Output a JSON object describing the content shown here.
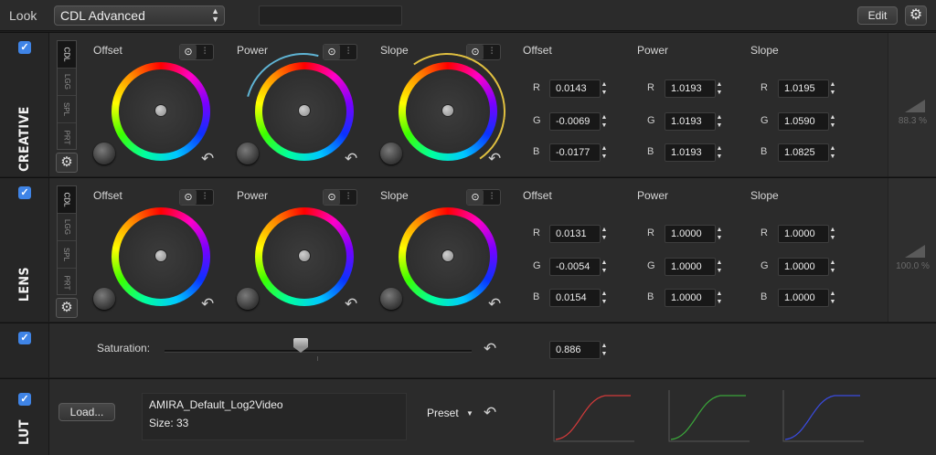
{
  "topbar": {
    "look_label": "Look",
    "look_value": "CDL Advanced",
    "edit_label": "Edit"
  },
  "modes": [
    "CDL",
    "LGG",
    "SPL",
    "PRT"
  ],
  "creative": {
    "label": "CREATIVE",
    "wheels": [
      "Offset",
      "Power",
      "Slope"
    ],
    "columns": [
      "Offset",
      "Power",
      "Slope"
    ],
    "rows": [
      {
        "ch": "R",
        "offset": "0.0143",
        "power": "1.0193",
        "slope": "1.0195"
      },
      {
        "ch": "G",
        "offset": "-0.0069",
        "power": "1.0193",
        "slope": "1.0590"
      },
      {
        "ch": "B",
        "offset": "-0.0177",
        "power": "1.0193",
        "slope": "1.0825"
      }
    ],
    "intensity": "88.3 %"
  },
  "lens": {
    "label": "LENS",
    "wheels": [
      "Offset",
      "Power",
      "Slope"
    ],
    "columns": [
      "Offset",
      "Power",
      "Slope"
    ],
    "rows": [
      {
        "ch": "R",
        "offset": "0.0131",
        "power": "1.0000",
        "slope": "1.0000"
      },
      {
        "ch": "G",
        "offset": "-0.0054",
        "power": "1.0000",
        "slope": "1.0000"
      },
      {
        "ch": "B",
        "offset": "0.0154",
        "power": "1.0000",
        "slope": "1.0000"
      }
    ],
    "intensity": "100.0 %"
  },
  "saturation": {
    "label": "Saturation:",
    "value": "0.886",
    "level": 0.886
  },
  "lut": {
    "label": "LUT",
    "load_label": "Load...",
    "name": "AMIRA_Default_Log2Video",
    "size": "Size:  33",
    "preset_label": "Preset",
    "curve_colors": [
      "#d23a3a",
      "#3aa53a",
      "#3a4be0"
    ]
  },
  "colors": {
    "checkbox": "#3f84e6",
    "panel": "#2b2b2b"
  }
}
